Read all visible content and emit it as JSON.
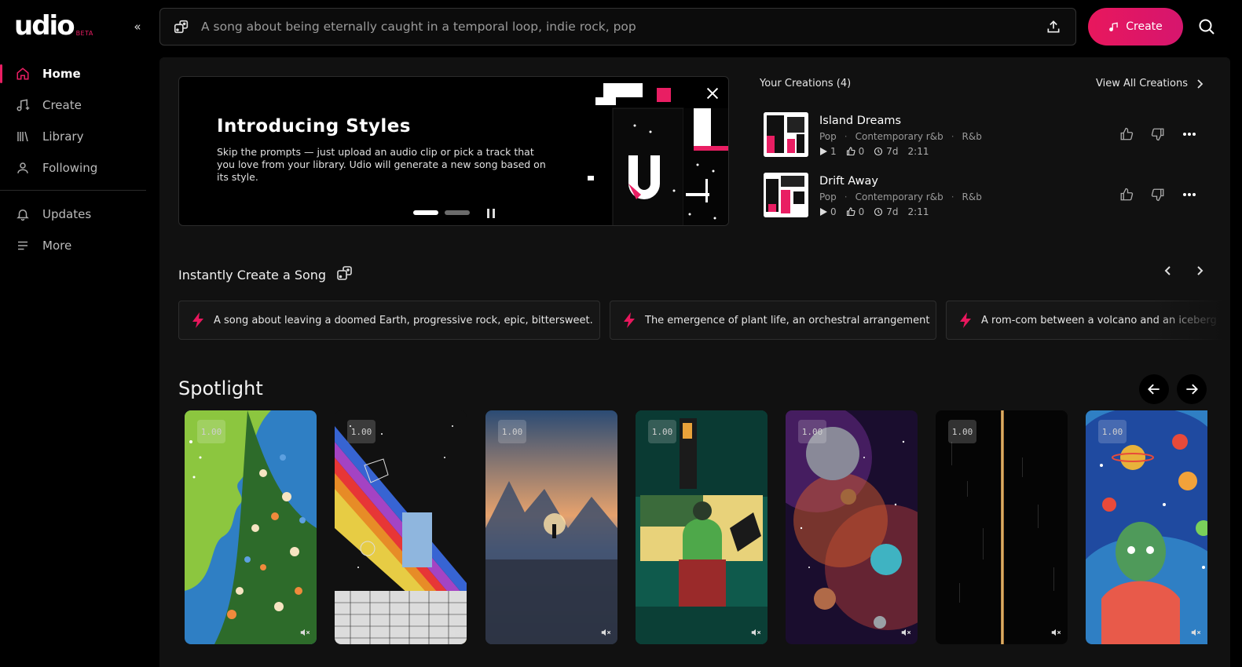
{
  "brand": {
    "name": "udio",
    "badge": "BETA",
    "accent": "#e91e63"
  },
  "sidebar": {
    "collapse_label": "«",
    "items": [
      {
        "label": "Home",
        "icon": "home-icon",
        "active": true
      },
      {
        "label": "Create",
        "icon": "music-note-icon"
      },
      {
        "label": "Library",
        "icon": "library-icon"
      },
      {
        "label": "Following",
        "icon": "user-icon"
      }
    ],
    "secondary": [
      {
        "label": "Updates",
        "icon": "bell-icon"
      },
      {
        "label": "More",
        "icon": "menu-icon"
      }
    ]
  },
  "search": {
    "placeholder": "A song about being eternally caught in a temporal loop, indie rock, pop"
  },
  "create_button": {
    "label": "Create"
  },
  "promo": {
    "title": "Introducing Styles",
    "text": "Skip the prompts — just upload an audio clip or pick a track that you love from your library. Udio will generate a new song based on its style."
  },
  "creations": {
    "heading": "Your Creations (4)",
    "view_all": "View All Creations",
    "tracks": [
      {
        "title": "Island Dreams",
        "tags": [
          "Pop",
          "Contemporary r&b",
          "R&b"
        ],
        "plays": "1",
        "likes": "0",
        "age": "7d",
        "duration": "2:11"
      },
      {
        "title": "Drift Away",
        "tags": [
          "Pop",
          "Contemporary r&b",
          "R&b"
        ],
        "plays": "0",
        "likes": "0",
        "age": "7d",
        "duration": "2:11"
      }
    ]
  },
  "instant": {
    "heading": "Instantly Create a Song",
    "prompts": [
      "A song about leaving a doomed Earth, progressive rock, epic, bittersweet.",
      "The emergence of plant life, an orchestral arrangement",
      "A rom-com between a volcano and an iceberg"
    ]
  },
  "spotlight": {
    "heading": "Spotlight",
    "cards": [
      {
        "badge": "1.00",
        "theme": "flower-face"
      },
      {
        "badge": "1.00",
        "theme": "rainbow-portal"
      },
      {
        "badge": "1.00",
        "theme": "misty-sunset"
      },
      {
        "badge": "1.00",
        "theme": "green-figure"
      },
      {
        "badge": "1.00",
        "theme": "cosmic-planets"
      },
      {
        "badge": "1.00",
        "theme": "dark-line"
      },
      {
        "badge": "1.00",
        "theme": "planet-hair"
      }
    ]
  }
}
